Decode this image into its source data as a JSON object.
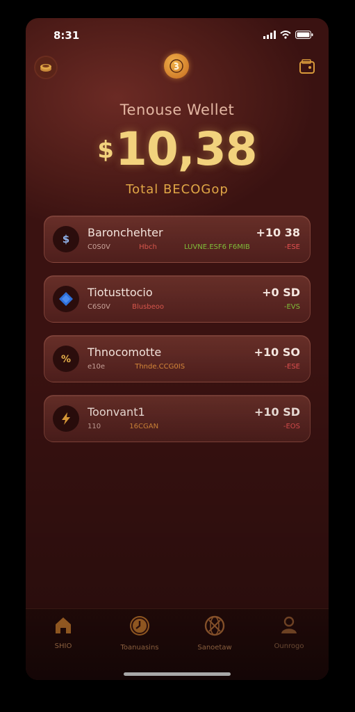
{
  "status": {
    "time": "8:31"
  },
  "header": {
    "title": "Tenouse Wellet",
    "currency": "$",
    "amount": "10,38",
    "subtitle": "Total BECOGop"
  },
  "assets": [
    {
      "name": "Baronchehter",
      "sub1": "C0S0V",
      "sub2": "Hbch",
      "sub3": "LUVNE.ESF6 F6MIB",
      "value": "+10 38",
      "change": "-ESE",
      "icon": "dollar-icon",
      "icon_color": "#8fb0e8"
    },
    {
      "name": "Tiotusttocio",
      "sub1": "C6S0V",
      "sub2": "Blusbeoo",
      "sub3": "",
      "value": "+0 SD",
      "change": "-EVS",
      "icon": "diamond-icon",
      "icon_color": "#2f6fd8"
    },
    {
      "name": "Thnocomotte",
      "sub1": "e10e",
      "sub2": "Thnde.CCG0IS",
      "sub3": "",
      "value": "+10 SO",
      "change": "-ESE",
      "icon": "fraction-icon",
      "icon_color": "#e6b04a"
    },
    {
      "name": "Toonvant1",
      "sub1": "110",
      "sub2": "16CGAN",
      "sub3": "",
      "value": "+10 SD",
      "change": "-EOS",
      "icon": "lightning-icon",
      "icon_color": "#e6a23a"
    }
  ],
  "tabs": [
    {
      "label": "SHIO",
      "icon": "home-icon"
    },
    {
      "label": "Toanuasins",
      "icon": "clock-icon"
    },
    {
      "label": "Sanoetaw",
      "icon": "globe-icon"
    },
    {
      "label": "Ounrogo",
      "icon": "profile-icon"
    }
  ],
  "colors": {
    "accent": "#f2d27d",
    "negative": "#e25050",
    "positive": "#7fbf3a"
  }
}
